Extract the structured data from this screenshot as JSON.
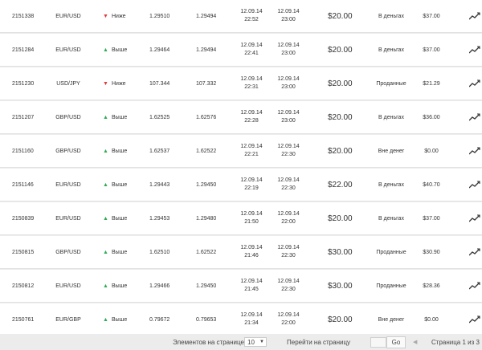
{
  "rows": [
    {
      "id": "2151338",
      "pair": "EUR/USD",
      "dir": "down",
      "dir_label": "Ниже",
      "open": "1.29510",
      "close": "1.29494",
      "t1d": "12.09.14",
      "t1t": "22:52",
      "t2d": "12.09.14",
      "t2t": "23:00",
      "amount": "$20.00",
      "status": "В деньгах",
      "payout": "$37.00"
    },
    {
      "id": "2151284",
      "pair": "EUR/USD",
      "dir": "up",
      "dir_label": "Выше",
      "open": "1.29464",
      "close": "1.29494",
      "t1d": "12.09.14",
      "t1t": "22:41",
      "t2d": "12.09.14",
      "t2t": "23:00",
      "amount": "$20.00",
      "status": "В деньгах",
      "payout": "$37.00"
    },
    {
      "id": "2151230",
      "pair": "USD/JPY",
      "dir": "down",
      "dir_label": "Ниже",
      "open": "107.344",
      "close": "107.332",
      "t1d": "12.09.14",
      "t1t": "22:31",
      "t2d": "12.09.14",
      "t2t": "23:00",
      "amount": "$20.00",
      "status": "Проданные",
      "payout": "$21.29"
    },
    {
      "id": "2151207",
      "pair": "GBP/USD",
      "dir": "up",
      "dir_label": "Выше",
      "open": "1.62525",
      "close": "1.62576",
      "t1d": "12.09.14",
      "t1t": "22:28",
      "t2d": "12.09.14",
      "t2t": "23:00",
      "amount": "$20.00",
      "status": "В деньгах",
      "payout": "$36.00"
    },
    {
      "id": "2151160",
      "pair": "GBP/USD",
      "dir": "up",
      "dir_label": "Выше",
      "open": "1.62537",
      "close": "1.62522",
      "t1d": "12.09.14",
      "t1t": "22:21",
      "t2d": "12.09.14",
      "t2t": "22:30",
      "amount": "$20.00",
      "status": "Вне денег",
      "payout": "$0.00"
    },
    {
      "id": "2151146",
      "pair": "EUR/USD",
      "dir": "up",
      "dir_label": "Выше",
      "open": "1.29443",
      "close": "1.29450",
      "t1d": "12.09.14",
      "t1t": "22:19",
      "t2d": "12.09.14",
      "t2t": "22:30",
      "amount": "$22.00",
      "status": "В деньгах",
      "payout": "$40.70"
    },
    {
      "id": "2150839",
      "pair": "EUR/USD",
      "dir": "up",
      "dir_label": "Выше",
      "open": "1.29453",
      "close": "1.29480",
      "t1d": "12.09.14",
      "t1t": "21:50",
      "t2d": "12.09.14",
      "t2t": "22:00",
      "amount": "$20.00",
      "status": "В деньгах",
      "payout": "$37.00"
    },
    {
      "id": "2150815",
      "pair": "GBP/USD",
      "dir": "up",
      "dir_label": "Выше",
      "open": "1.62510",
      "close": "1.62522",
      "t1d": "12.09.14",
      "t1t": "21:46",
      "t2d": "12.09.14",
      "t2t": "22:30",
      "amount": "$30.00",
      "status": "Проданные",
      "payout": "$30.90"
    },
    {
      "id": "2150812",
      "pair": "EUR/USD",
      "dir": "up",
      "dir_label": "Выше",
      "open": "1.29466",
      "close": "1.29450",
      "t1d": "12.09.14",
      "t1t": "21:45",
      "t2d": "12.09.14",
      "t2t": "22:30",
      "amount": "$30.00",
      "status": "Проданные",
      "payout": "$28.36"
    },
    {
      "id": "2150761",
      "pair": "EUR/GBP",
      "dir": "up",
      "dir_label": "Выше",
      "open": "0.79672",
      "close": "0.79653",
      "t1d": "12.09.14",
      "t1t": "21:34",
      "t2d": "12.09.14",
      "t2t": "22:00",
      "amount": "$20.00",
      "status": "Вне денег",
      "payout": "$0.00"
    }
  ],
  "icons": {
    "up": "arrow-up-icon",
    "down": "arrow-down-icon",
    "chart": "chart-trend-icon",
    "select": "chevron-down-icon",
    "prev": "chevron-left-icon"
  },
  "colors": {
    "up": "#2eaa55",
    "down": "#e03a3a",
    "row_bg": "#ffffff",
    "page_bg": "#ececec"
  },
  "footer": {
    "per_page_label": "Элементов на странице",
    "per_page_value": "10",
    "goto_label": "Перейти на страницу",
    "go_label": "Go",
    "page_info": "Страница 1 из 3"
  }
}
